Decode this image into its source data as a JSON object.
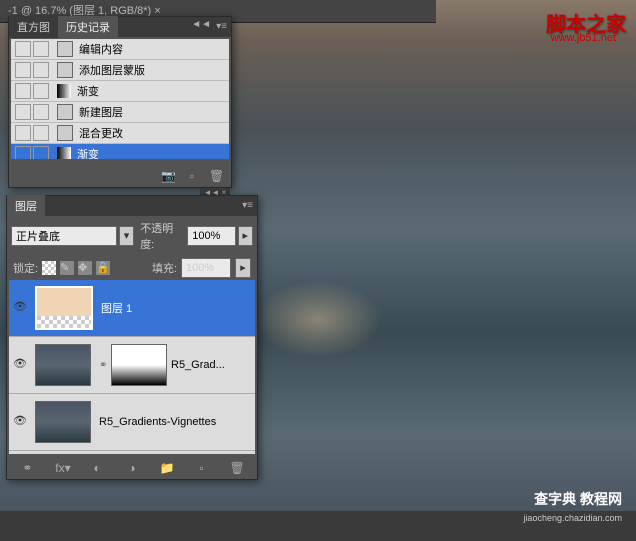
{
  "doc_tab": "-1 @ 16.7% (图层 1, RGB/8*) ×",
  "watermark": {
    "top": "脚本之家",
    "top_sub": "www.jb51.net",
    "bottom": "查字典 教程网",
    "bottom_sub": "jiaocheng.chazidian.com"
  },
  "history": {
    "tab1": "直方图",
    "tab2": "历史记录",
    "items": [
      {
        "label": "编辑内容",
        "icon": "doc"
      },
      {
        "label": "添加图层蒙版",
        "icon": "doc"
      },
      {
        "label": "渐变",
        "icon": "grad"
      },
      {
        "label": "新建图层",
        "icon": "doc"
      },
      {
        "label": "混合更改",
        "icon": "doc"
      },
      {
        "label": "渐变",
        "icon": "grad",
        "selected": true
      }
    ]
  },
  "layers": {
    "tab": "图层",
    "blend_mode": "正片叠底",
    "opacity_label": "不透明度:",
    "opacity_value": "100%",
    "lock_label": "锁定:",
    "fill_label": "填充:",
    "fill_value": "100%",
    "items": [
      {
        "name": "图层 1",
        "selected": true,
        "thumb": "tan"
      },
      {
        "name": "R5_Grad...",
        "thumb": "img",
        "mask": true
      },
      {
        "name": "R5_Gradients-Vignettes",
        "thumb": "img"
      }
    ]
  }
}
